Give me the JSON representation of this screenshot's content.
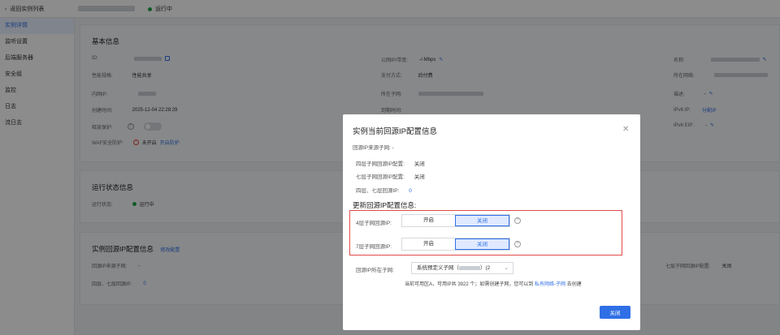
{
  "topbar": {
    "back_label": "返回实例列表",
    "status": "运行中"
  },
  "sidebar": {
    "items": [
      {
        "label": "实例详情",
        "active": true
      },
      {
        "label": "监听设置"
      },
      {
        "label": "后端服务器"
      },
      {
        "label": "安全组"
      },
      {
        "label": "监控"
      },
      {
        "label": "日志"
      },
      {
        "label": "流日志"
      }
    ]
  },
  "basic": {
    "title": "基本信息",
    "id_label": "ID:",
    "spec_label": "性能规格:",
    "spec_value": "性能共享",
    "ip_label": "内网IP:",
    "created_label": "创建时间:",
    "created_value": "2025-12-04 22:28:29",
    "protect_label": "释放保护:",
    "waf_label": "WAF安全防护:",
    "waf_value": "未开启",
    "waf_link": "开启防护",
    "bandwidth_label": "公网IP/带宽:",
    "bandwidth_value": "-/-Mbps",
    "pay_label": "支付方式:",
    "pay_value": "后付费",
    "subnet_label": "所在子网:",
    "expire_label": "到期时间:",
    "name_label": "名称:",
    "vpc_label": "所在网络:",
    "desc_label": "描述:",
    "desc_value": "-",
    "ipv6_label": "IPv6 IP:",
    "ipv6_link": "分配IP",
    "ipv6eip_label": "IPv6 EIP:",
    "ipv6eip_value": "-"
  },
  "runstate": {
    "title": "运行状态信息",
    "label": "运行状态:",
    "value": "运行中"
  },
  "origin": {
    "title": "实例回源IP配置信息",
    "edit_link": "修改配置",
    "subnet_label": "回源IP来源子网:",
    "subnet_value": "-",
    "l47_label": "四层、七层回源IP:",
    "l47_value": "0",
    "l7_label": "七层子网回源IP配置:",
    "l7_value": "关闭"
  },
  "modal": {
    "title": "实例当前回源IP配置信息",
    "source_label": "回源IP来源子网:",
    "source_value": "-",
    "l4_label": "四层子网回源IP配置:",
    "l4_value": "关闭",
    "l7_label": "七层子网回源IP配置:",
    "l7_value": "关闭",
    "l47_label": "四层、七层回源IP:",
    "l47_value": "0",
    "section": "更新回源IP配置信息:",
    "row4_label": "4层子网回源IP:",
    "row7_label": "7层子网回源IP:",
    "on_label": "开启",
    "off_label": "关闭",
    "subnet_label": "回源IP所在子网:",
    "subnet_value": "系统预定义子网（",
    "subnet_suffix": "）(2",
    "hint": "当前可用区A，可用IP共 3922 个；如需创建子网，您可以到",
    "hint_link": "私有网络-子网",
    "hint_tail": "去创建",
    "close_button": "关闭"
  }
}
